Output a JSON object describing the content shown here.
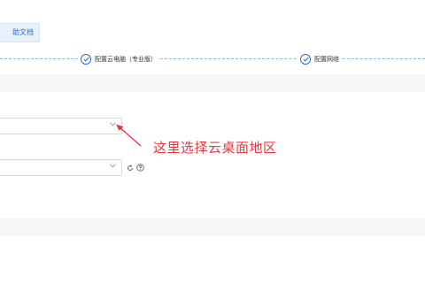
{
  "toolbar": {
    "help_docs_label": "助文档"
  },
  "steps": [
    {
      "label": "配置云电脑（专业版）",
      "status": "done"
    },
    {
      "label": "配置网络",
      "status": "done"
    }
  ],
  "form": {
    "region_select": {
      "value": "",
      "icon": "chevron-down-icon"
    },
    "second_select": {
      "value": "",
      "icon": "chevron-down-icon"
    },
    "refresh_icon": "refresh-icon",
    "help_icon": "question-circle-icon"
  },
  "annotation": {
    "text": "这里选择云桌面地区",
    "color": "#e8383d"
  },
  "colors": {
    "accent": "#1f6fd6",
    "band": "#f5f6f8",
    "border": "#d6d9de"
  }
}
